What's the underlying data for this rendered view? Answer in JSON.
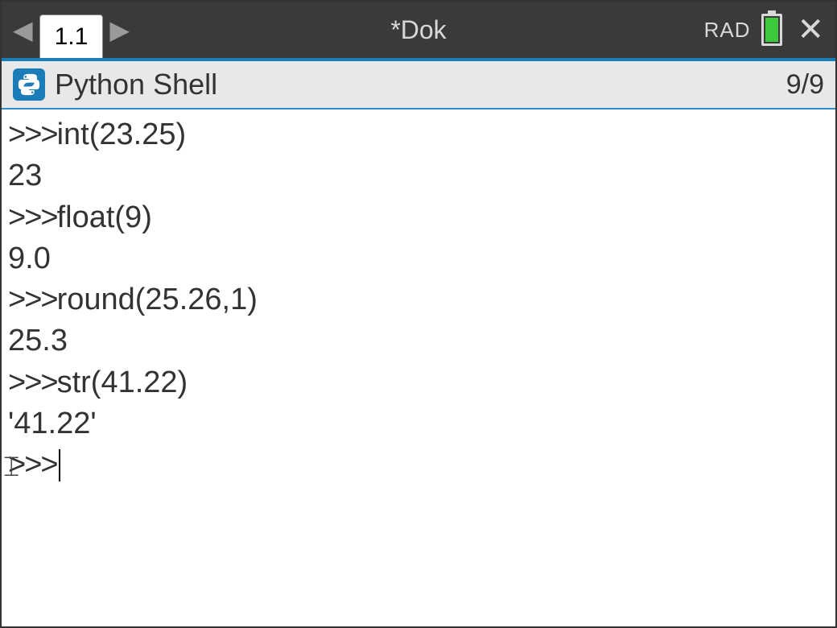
{
  "titlebar": {
    "tab_label": "1.1",
    "document_title": "*Dok",
    "angle_mode": "RAD"
  },
  "shell_header": {
    "title": "Python Shell",
    "counter": "9/9"
  },
  "shell": {
    "lines": [
      {
        "prompt": ">>>",
        "text": "int(23.25)"
      },
      {
        "prompt": "",
        "text": "23"
      },
      {
        "prompt": ">>>",
        "text": "float(9)"
      },
      {
        "prompt": "",
        "text": "9.0"
      },
      {
        "prompt": ">>>",
        "text": "round(25.26,1)"
      },
      {
        "prompt": "",
        "text": "25.3"
      },
      {
        "prompt": ">>>",
        "text": "str(41.22)"
      },
      {
        "prompt": "",
        "text": "'41.22'"
      }
    ],
    "active_prompt": ">>>"
  }
}
